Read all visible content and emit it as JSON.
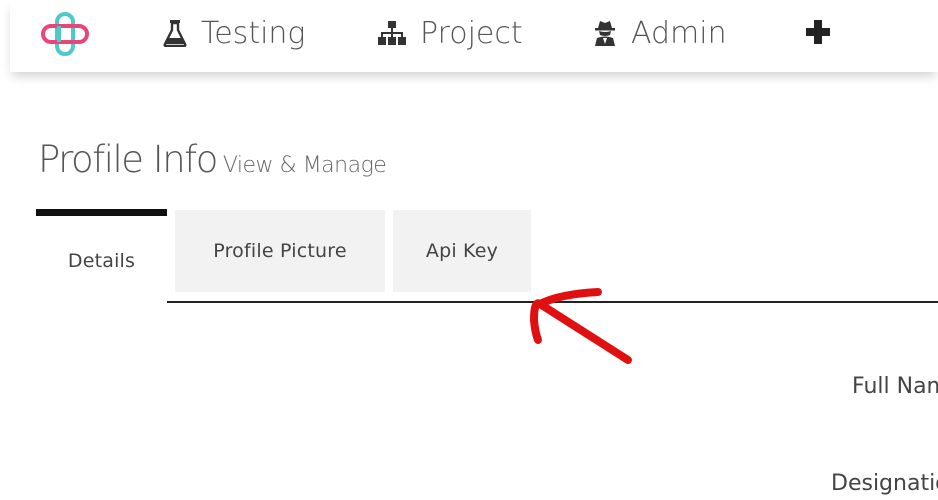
{
  "nav": {
    "items": [
      {
        "label": "Testing",
        "icon": "flask-icon"
      },
      {
        "label": "Project",
        "icon": "sitemap-icon"
      },
      {
        "label": "Admin",
        "icon": "user-secret-icon"
      }
    ],
    "add_icon": "plus-icon"
  },
  "heading": {
    "title": "Profile Info",
    "subtitle": "View & Manage"
  },
  "tabs": [
    {
      "label": "Details",
      "active": true
    },
    {
      "label": "Profile Picture",
      "active": false
    },
    {
      "label": "Api Key",
      "active": false
    }
  ],
  "form": {
    "labels": [
      "Full Name",
      "Designation"
    ]
  },
  "colors": {
    "logo_pink": "#e9457a",
    "logo_teal": "#4ec9c6",
    "annotation_red": "#e01010",
    "tab_inactive_bg": "#f2f2f2",
    "active_tab_bar": "#111111"
  }
}
